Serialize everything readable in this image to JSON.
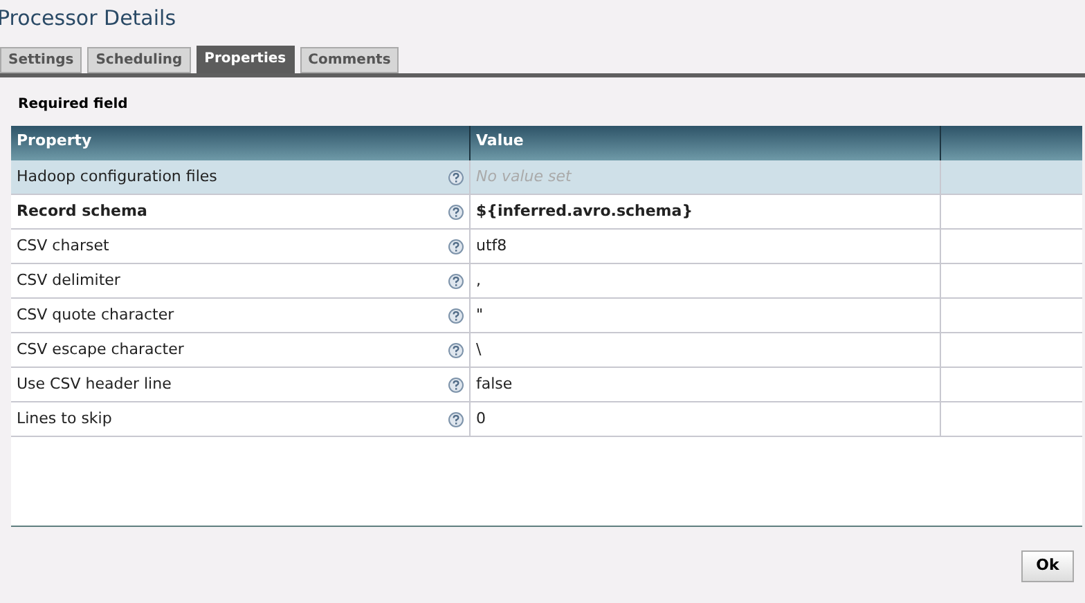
{
  "window": {
    "title": "Processor Details"
  },
  "tabs": [
    {
      "label": "Settings",
      "selected": false
    },
    {
      "label": "Scheduling",
      "selected": false
    },
    {
      "label": "Properties",
      "selected": true
    },
    {
      "label": "Comments",
      "selected": false
    }
  ],
  "legend": "Required field",
  "table": {
    "columns": [
      "Property",
      "Value"
    ],
    "rows": [
      {
        "name": "Hadoop configuration files",
        "placeholder": "No value set",
        "required": false,
        "selected": true
      },
      {
        "name": "Record schema",
        "value": "${inferred.avro.schema}",
        "required": true,
        "selected": false
      },
      {
        "name": "CSV charset",
        "value": "utf8",
        "required": false,
        "selected": false
      },
      {
        "name": "CSV delimiter",
        "value": ",",
        "required": false,
        "selected": false
      },
      {
        "name": "CSV quote character",
        "value": "\"",
        "required": false,
        "selected": false
      },
      {
        "name": "CSV escape character",
        "value": "\\",
        "required": false,
        "selected": false
      },
      {
        "name": "Use CSV header line",
        "value": "false",
        "required": false,
        "selected": false
      },
      {
        "name": "Lines to skip",
        "value": "0",
        "required": false,
        "selected": false
      }
    ]
  },
  "buttons": [
    "Ok"
  ]
}
